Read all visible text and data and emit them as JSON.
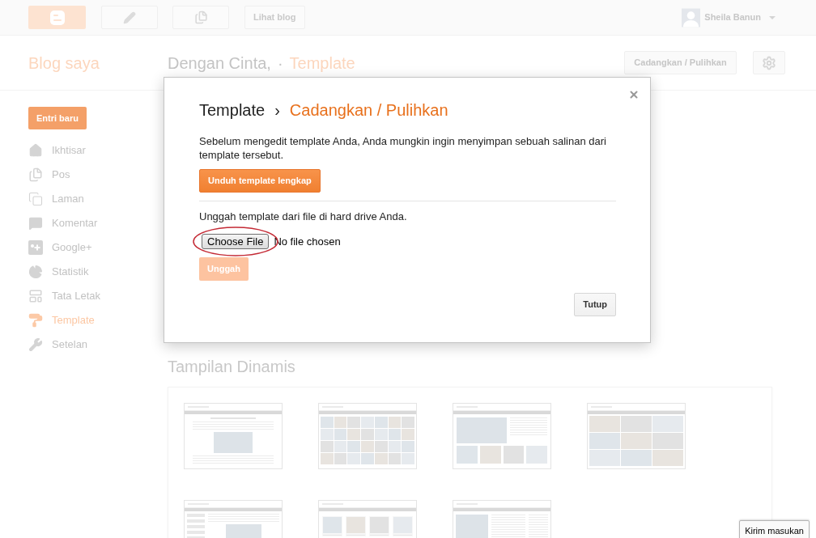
{
  "top_bar": {
    "view_blog_button": "Lihat blog",
    "user_name": "Sheila Banun"
  },
  "header": {
    "app_title": "Blog saya",
    "blog_name": "Dengan Cinta,",
    "separator": "·",
    "page_title": "Template",
    "backup_button": "Cadangkan / Pulihkan"
  },
  "sidebar": {
    "new_post_button": "Entri baru",
    "items": [
      {
        "label": "Ikhtisar",
        "kind": "home",
        "selected": false
      },
      {
        "label": "Pos",
        "kind": "posts",
        "selected": false
      },
      {
        "label": "Laman",
        "kind": "pages",
        "selected": false
      },
      {
        "label": "Komentar",
        "kind": "comments",
        "selected": false
      },
      {
        "label": "Google+",
        "kind": "google_plus",
        "selected": false
      },
      {
        "label": "Statistik",
        "kind": "stats",
        "selected": false
      },
      {
        "label": "Tata Letak",
        "kind": "layout",
        "selected": false
      },
      {
        "label": "Template",
        "kind": "template",
        "selected": true
      },
      {
        "label": "Setelan",
        "kind": "settings",
        "selected": false
      }
    ]
  },
  "main": {
    "section_title": "Tampilan Dinamis",
    "template_previews": [
      {
        "kind": "article"
      },
      {
        "kind": "grid"
      },
      {
        "kind": "feature"
      },
      {
        "kind": "collage"
      },
      {
        "kind": "sidebar"
      },
      {
        "kind": "cards"
      },
      {
        "kind": "columns"
      }
    ]
  },
  "dialog": {
    "title": "Template",
    "title_separator": "›",
    "subtitle": "Cadangkan / Pulihkan",
    "description": "Sebelum mengedit template Anda, Anda mungkin ingin menyimpan sebuah salinan dari template tersebut.",
    "download_button": "Unduh template lengkap",
    "upload_label": "Unggah template dari file di hard drive Anda.",
    "file_input": {
      "button": "Choose File",
      "status": "No file chosen"
    },
    "upload_button": {
      "label": "Unggah",
      "disabled": true
    },
    "close_button": "Tutup"
  },
  "feedback_button": "Kirim masukan"
}
